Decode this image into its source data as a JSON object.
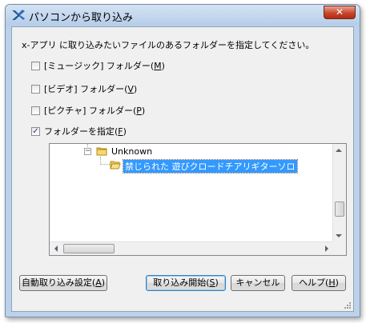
{
  "window": {
    "title": "パソコンから取り込み",
    "close_glyph": "✕"
  },
  "instruction": "x-アプリ に取り込みたいファイルのあるフォルダーを指定してください。",
  "options": [
    {
      "label_prefix": "[ミュージック] フォルダー(",
      "mnemonic": "M",
      "label_suffix": ")",
      "checked": false
    },
    {
      "label_prefix": "[ビデオ] フォルダー(",
      "mnemonic": "V",
      "label_suffix": ")",
      "checked": false
    },
    {
      "label_prefix": "[ピクチャ] フォルダー(",
      "mnemonic": "P",
      "label_suffix": ")",
      "checked": false
    },
    {
      "label_prefix": "フォルダーを指定(",
      "mnemonic": "F",
      "label_suffix": ")",
      "checked": true
    }
  ],
  "check_glyph": "✓",
  "tree": {
    "expander_glyph": "−",
    "parent_node": "Unknown",
    "selected_node": "禁じられた 遊びクロードチアリギターソロ"
  },
  "buttons": {
    "auto_import": {
      "prefix": "自動取り込み設定(",
      "mnemonic": "A",
      "suffix": ")"
    },
    "start_import": {
      "prefix": "取り込み開始(",
      "mnemonic": "S",
      "suffix": ")"
    },
    "cancel": "キャンセル",
    "help": {
      "prefix": "ヘルプ(",
      "mnemonic": "H",
      "suffix": ")"
    }
  },
  "colors": {
    "selection": "#3399ff",
    "close_button": "#c8472c",
    "check": "#1a3c8c"
  }
}
